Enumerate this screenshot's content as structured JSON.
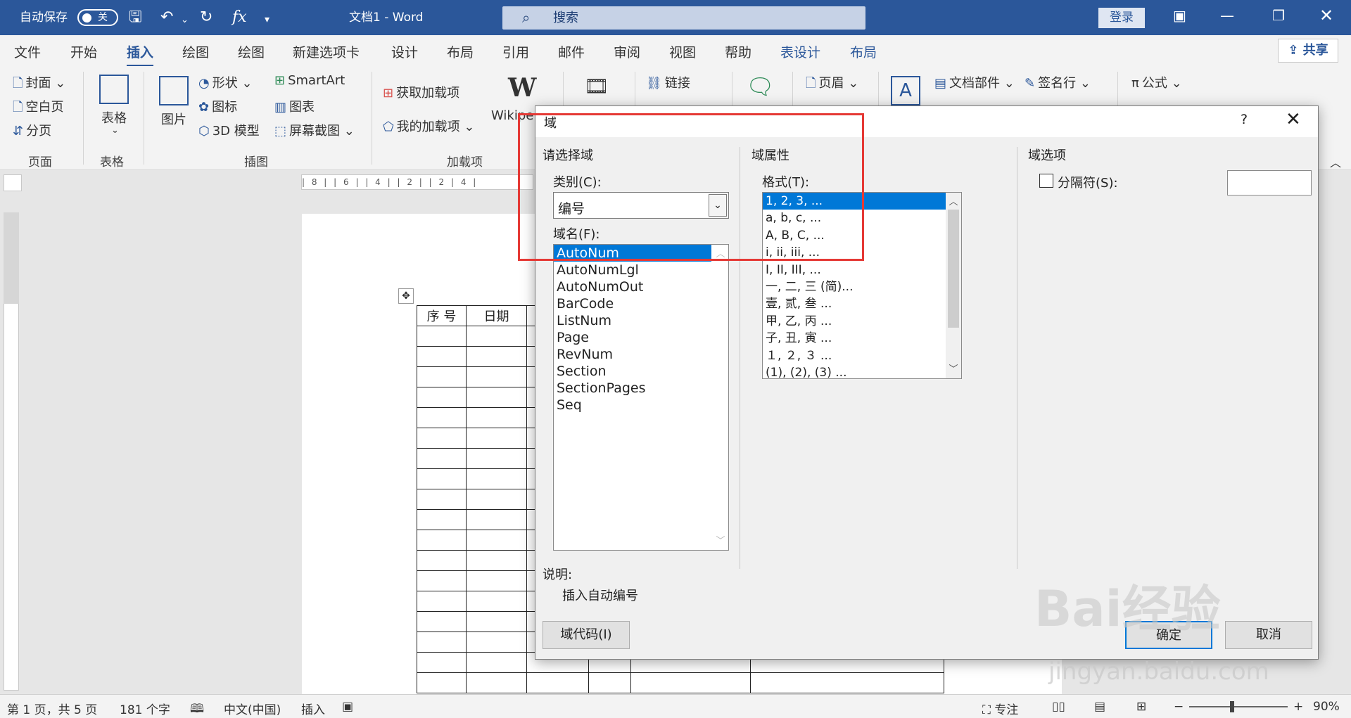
{
  "titlebar": {
    "autosave_label": "自动保存",
    "autosave_state": "关",
    "doc_title": "文档1 - Word",
    "search_placeholder": "搜索",
    "login_label": "登录"
  },
  "tabs": [
    "文件",
    "开始",
    "插入",
    "绘图",
    "绘图",
    "新建选项卡",
    "设计",
    "布局",
    "引用",
    "邮件",
    "审阅",
    "视图",
    "帮助",
    "表设计",
    "布局"
  ],
  "share_label": "共享",
  "ribbon": {
    "pages": [
      "封面",
      "空白页",
      "分页"
    ],
    "table_label": "表格",
    "picture_label": "图片",
    "shapes": "形状",
    "icons": "图标",
    "model3d": "3D 模型",
    "smartart": "SmartArt",
    "chart": "图表",
    "screenshot": "屏幕截图",
    "get_addins": "获取加载项",
    "my_addins": "我的加载项",
    "wikipedia": "Wikipe",
    "link": "链接",
    "header": "页眉",
    "docparts": "文档部件",
    "signature": "签名行",
    "equation": "公式",
    "groups": {
      "page": "页面",
      "table": "表格",
      "illustrations": "插图",
      "addins": "加载项"
    }
  },
  "document": {
    "table_headers": [
      "序 号",
      "日期"
    ]
  },
  "statusbar": {
    "page": "第 1 页，共 5 页",
    "words": "181 个字",
    "language": "中文(中国)",
    "mode": "插入",
    "focus": "专注",
    "zoom": "90%"
  },
  "dialog": {
    "title": "域",
    "help": "?",
    "choose_field": "请选择域",
    "category_label": "类别(C):",
    "category_value": "编号",
    "field_names_label": "域名(F):",
    "field_names": [
      "AutoNum",
      "AutoNumLgl",
      "AutoNumOut",
      "BarCode",
      "ListNum",
      "Page",
      "RevNum",
      "Section",
      "SectionPages",
      "Seq"
    ],
    "field_properties": "域属性",
    "format_label": "格式(T):",
    "formats": [
      "1, 2, 3, ...",
      "a, b, c, ...",
      "A, B, C, ...",
      "i, ii, iii, ...",
      "I, II, III, ...",
      "一, 二, 三 (简)...",
      "壹, 贰, 叁 ...",
      "甲, 乙, 丙 ...",
      "子, 丑, 寅 ...",
      "１, ２, ３ ...",
      "(1), (2), (3) ..."
    ],
    "field_options": "域选项",
    "separator_label": "分隔符(S):",
    "description_label": "说明:",
    "description_text": "插入自动编号",
    "field_codes_button": "域代码(I)",
    "ok_button": "确定",
    "cancel_button": "取消"
  },
  "watermark": {
    "brand": "Bai经验",
    "url": "jingyan.baidu.com"
  }
}
